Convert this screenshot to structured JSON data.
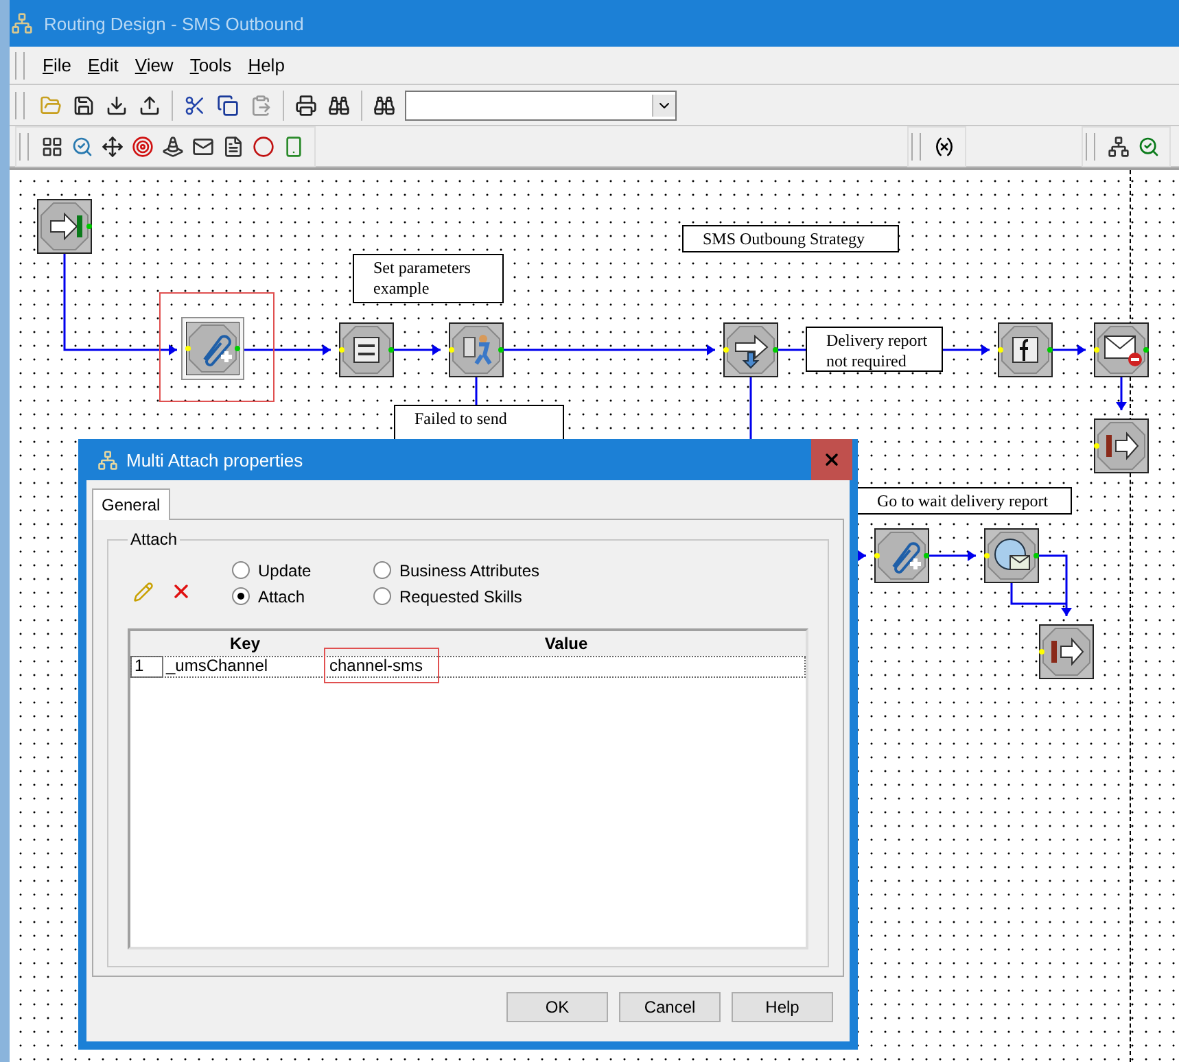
{
  "window": {
    "title": "Routing Design - SMS Outbound"
  },
  "menu": [
    {
      "label": "File"
    },
    {
      "label": "Edit"
    },
    {
      "label": "View"
    },
    {
      "label": "Tools"
    },
    {
      "label": "Help"
    }
  ],
  "diagram": {
    "nodes": [
      {
        "kind": "entry",
        "highlighted": false
      },
      {
        "kind": "attach",
        "highlighted": true
      },
      {
        "kind": "list",
        "highlighted": false
      },
      {
        "kind": "agent",
        "highlighted": false
      },
      {
        "kind": "branch",
        "highlighted": false
      },
      {
        "kind": "function",
        "highlighted": false
      },
      {
        "kind": "mail-stop",
        "highlighted": false
      },
      {
        "kind": "exit",
        "highlighted": false
      },
      {
        "kind": "attach",
        "highlighted": false
      },
      {
        "kind": "wait",
        "highlighted": false
      },
      {
        "kind": "exit",
        "highlighted": false
      }
    ],
    "notes": [
      {
        "text": "Set parameters example"
      },
      {
        "text": "Failed to send"
      },
      {
        "text": "SMS Outboung Strategy"
      },
      {
        "text": "Delivery report not required"
      },
      {
        "text": "Go to wait delivery report"
      }
    ]
  },
  "dialog": {
    "title": "Multi Attach properties",
    "tabs": [
      {
        "label": "General",
        "selected": true
      }
    ],
    "group": "Attach",
    "options": [
      {
        "label": "Update",
        "checked": false
      },
      {
        "label": "Attach",
        "checked": true
      },
      {
        "label": "Business Attributes",
        "checked": false
      },
      {
        "label": "Requested Skills",
        "checked": false
      }
    ],
    "grid": {
      "columns": [
        "Key",
        "Value"
      ],
      "rows": [
        {
          "number": "1",
          "key": "_umsChannel",
          "value": "channel-sms",
          "value_highlighted": true
        }
      ]
    },
    "buttons": [
      "OK",
      "Cancel",
      "Help"
    ]
  }
}
